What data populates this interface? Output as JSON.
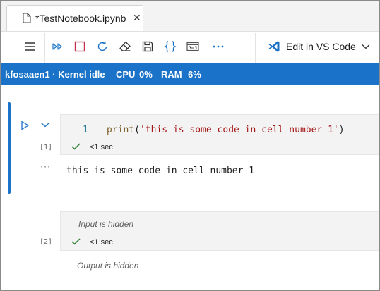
{
  "tab": {
    "title": "*TestNotebook.ipynb",
    "file_icon": "file-icon",
    "close_icon": "close-icon"
  },
  "toolbar": {
    "icons": [
      "menu-icon",
      "run-all-icon",
      "stop-icon",
      "restart-icon",
      "clear-icon",
      "save-icon",
      "variables-icon",
      "export-icon",
      "more-icon"
    ],
    "edit_vscode_label": "Edit in VS Code",
    "vscode_icon": "vscode-icon"
  },
  "status": {
    "kernel": "kfosaaen1 · Kernel idle",
    "cpu_label": "CPU",
    "cpu_value": "0%",
    "ram_label": "RAM",
    "ram_value": "6%"
  },
  "cells": [
    {
      "exec_count": "[1]",
      "line_number": "1",
      "code": {
        "fn": "print",
        "open": "(",
        "str": "'this is some code in cell number 1'",
        "close": ")"
      },
      "exec_time": "<1 sec",
      "output_more": "···",
      "output": "this is some code in cell number 1"
    },
    {
      "exec_count": "[2]",
      "input_hidden": "Input is hidden",
      "exec_time": "<1 sec",
      "output_hidden": "Output is hidden"
    }
  ],
  "colors": {
    "accent": "#1a73c8",
    "stop": "#c4314b",
    "success": "#2e7d32"
  }
}
